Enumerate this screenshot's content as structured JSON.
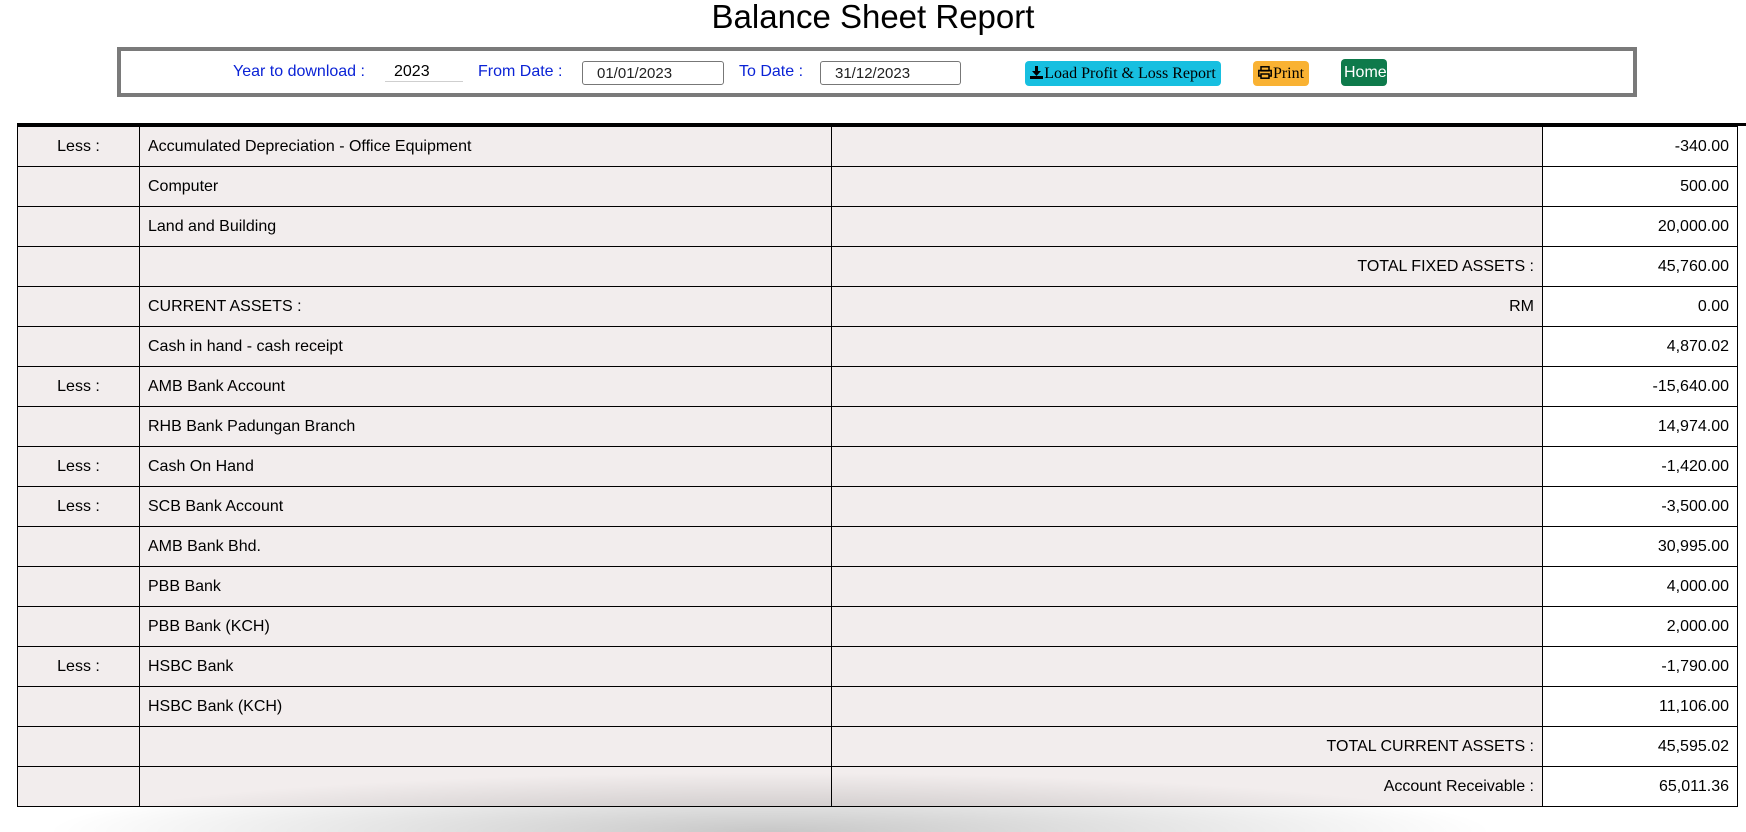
{
  "title": "Balance Sheet Report",
  "toolbar": {
    "year_label": "Year to download :",
    "year_value": "2023",
    "from_label": "From Date :",
    "from_value": "01/01/2023",
    "to_label": "To Date :",
    "to_value": "31/12/2023",
    "load_label": "Load Profit & Loss Report",
    "print_label": "Print",
    "home_label": "Home"
  },
  "colors": {
    "label_blue": "#0b23d6",
    "load_button": "#17bfe0",
    "print_button": "#f9b233",
    "home_button": "#0e7a4b",
    "row_background": "#f2eded"
  },
  "rows": [
    {
      "prefix": "Less :",
      "description": "Accumulated Depreciation - Office Equipment",
      "summary": "",
      "amount": "-340.00"
    },
    {
      "prefix": "",
      "description": "Computer",
      "summary": "",
      "amount": "500.00"
    },
    {
      "prefix": "",
      "description": "Land and Building",
      "summary": "",
      "amount": "20,000.00"
    },
    {
      "prefix": "",
      "description": "",
      "summary": "TOTAL FIXED ASSETS :",
      "amount": "45,760.00"
    },
    {
      "prefix": "",
      "description": "CURRENT ASSETS :",
      "summary": "RM",
      "amount": "0.00"
    },
    {
      "prefix": "",
      "description": "Cash in hand - cash receipt",
      "summary": "",
      "amount": "4,870.02"
    },
    {
      "prefix": "Less :",
      "description": "AMB Bank Account",
      "summary": "",
      "amount": "-15,640.00"
    },
    {
      "prefix": "",
      "description": "RHB Bank Padungan Branch",
      "summary": "",
      "amount": "14,974.00"
    },
    {
      "prefix": "Less :",
      "description": "Cash On Hand",
      "summary": "",
      "amount": "-1,420.00"
    },
    {
      "prefix": "Less :",
      "description": "SCB Bank Account",
      "summary": "",
      "amount": "-3,500.00"
    },
    {
      "prefix": "",
      "description": "AMB Bank Bhd.",
      "summary": "",
      "amount": "30,995.00"
    },
    {
      "prefix": "",
      "description": "PBB Bank",
      "summary": "",
      "amount": "4,000.00"
    },
    {
      "prefix": "",
      "description": "PBB Bank (KCH)",
      "summary": "",
      "amount": "2,000.00"
    },
    {
      "prefix": "Less :",
      "description": "HSBC Bank",
      "summary": "",
      "amount": "-1,790.00"
    },
    {
      "prefix": "",
      "description": "HSBC Bank (KCH)",
      "summary": "",
      "amount": "11,106.00"
    },
    {
      "prefix": "",
      "description": "",
      "summary": "TOTAL CURRENT ASSETS :",
      "amount": "45,595.02"
    },
    {
      "prefix": "",
      "description": "",
      "summary": "Account Receivable :",
      "amount": "65,011.36"
    }
  ]
}
